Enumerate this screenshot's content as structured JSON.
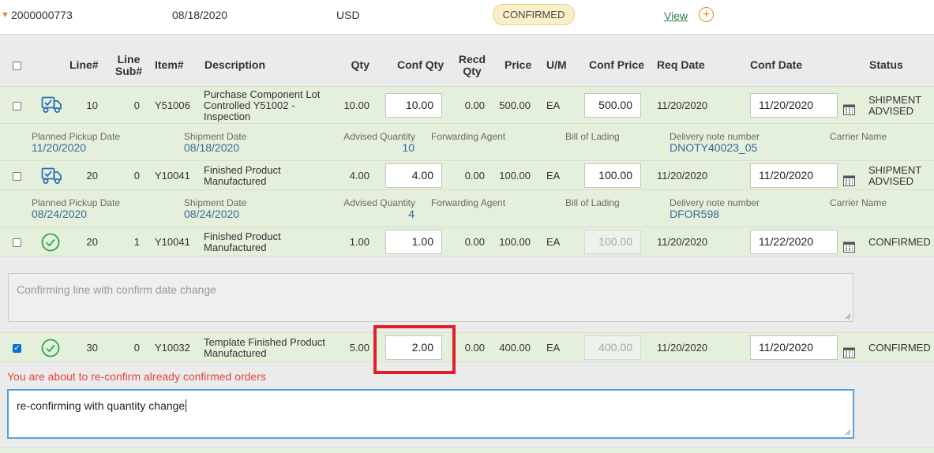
{
  "order": {
    "number": "2000000773",
    "date": "08/18/2020",
    "currency": "USD",
    "status": "CONFIRMED",
    "view_label": "View",
    "add_label": "+"
  },
  "columns": {
    "line": "Line#",
    "line_sub": [
      "Line",
      "Sub#"
    ],
    "item": "Item#",
    "description": "Description",
    "qty": "Qty",
    "conf_qty": "Conf Qty",
    "recd_qty": [
      "Recd",
      "Qty"
    ],
    "price": "Price",
    "uom": "U/M",
    "conf_price": "Conf Price",
    "req_date": "Req Date",
    "conf_date": "Conf Date",
    "status": "Status"
  },
  "detail_labels": {
    "pickup": "Planned Pickup Date",
    "shipment": "Shipment Date",
    "advised": "Advised Quantity",
    "agent": "Forwarding Agent",
    "bol": "Bill of Lading",
    "delivery_note": "Delivery note number",
    "carrier": "Carrier Name"
  },
  "rows": [
    {
      "icon": "truck-icon",
      "checked": false,
      "line": "10",
      "sub": "0",
      "item": "Y51006",
      "desc": [
        "Purchase Component Lot",
        "Controlled Y51002 -",
        "Inspection"
      ],
      "qty": "10.00",
      "conf_qty": "10.00",
      "recd_qty": "0.00",
      "price": "500.00",
      "uom": "EA",
      "conf_price": "500.00",
      "conf_price_disabled": false,
      "req_date": "11/20/2020",
      "conf_date": "11/20/2020",
      "status": [
        "SHIPMENT",
        "ADVISED"
      ],
      "detail": {
        "pickup": "11/20/2020",
        "shipment": "08/18/2020",
        "advised": "10",
        "delivery_note": "DNOTY40023_05"
      }
    },
    {
      "icon": "truck-icon",
      "checked": false,
      "line": "20",
      "sub": "0",
      "item": "Y10041",
      "desc": [
        "Finished Product",
        "Manufactured"
      ],
      "qty": "4.00",
      "conf_qty": "4.00",
      "recd_qty": "0.00",
      "price": "100.00",
      "uom": "EA",
      "conf_price": "100.00",
      "conf_price_disabled": false,
      "req_date": "11/20/2020",
      "conf_date": "11/20/2020",
      "status": [
        "SHIPMENT",
        "ADVISED"
      ],
      "detail": {
        "pickup": "08/24/2020",
        "shipment": "08/24/2020",
        "advised": "4",
        "delivery_note": "DFOR598"
      }
    },
    {
      "icon": "check-circle-icon",
      "checked": false,
      "line": "20",
      "sub": "1",
      "item": "Y10041",
      "desc": [
        "Finished Product",
        "Manufactured"
      ],
      "qty": "1.00",
      "conf_qty": "1.00",
      "recd_qty": "0.00",
      "price": "100.00",
      "uom": "EA",
      "conf_price": "100.00",
      "conf_price_disabled": true,
      "req_date": "11/20/2020",
      "conf_date": "11/22/2020",
      "status": [
        "CONFIRMED"
      ],
      "comment_placeholder": "Confirming line with confirm date change"
    },
    {
      "icon": "check-circle-icon",
      "checked": true,
      "line": "30",
      "sub": "0",
      "item": "Y10032",
      "desc": [
        "Template Finished Product",
        "Manufactured"
      ],
      "qty": "5.00",
      "conf_qty": "2.00",
      "recd_qty": "0.00",
      "price": "400.00",
      "uom": "EA",
      "conf_price": "400.00",
      "conf_price_disabled": true,
      "req_date": "11/20/2020",
      "conf_date": "11/20/2020",
      "status": [
        "CONFIRMED"
      ],
      "warning": "You are about to re-confirm already confirmed orders",
      "comment_value": "re-confirming with quantity change"
    }
  ],
  "colors": {
    "accent": "#e08a27",
    "link": "#2e7a43",
    "row_bg": "#e4efdc",
    "icon_blue": "#2c6fb7",
    "icon_green": "#2ea84a",
    "warning": "#e0463d",
    "highlight": "#e11e2c"
  }
}
